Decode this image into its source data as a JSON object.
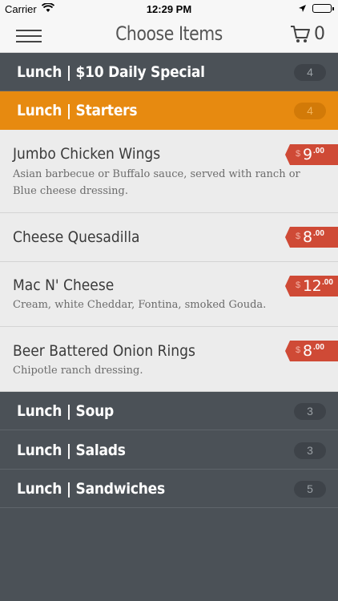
{
  "status_bar": {
    "carrier": "Carrier",
    "time": "12:29 PM"
  },
  "nav": {
    "title": "Choose Items",
    "cart_count": "0"
  },
  "sections_top": [
    {
      "label": "Lunch | $10 Daily Special",
      "count": "4"
    },
    {
      "label": "Lunch | Starters",
      "count": "4"
    }
  ],
  "items": [
    {
      "name": "Jumbo Chicken Wings",
      "description": "Asian barbecue or Buffalo sauce, served with ranch or Blue cheese dressing.",
      "currency": "$",
      "price": "9",
      "cents": ".00"
    },
    {
      "name": "Cheese Quesadilla",
      "description": "",
      "currency": "$",
      "price": "8",
      "cents": ".00"
    },
    {
      "name": "Mac N' Cheese",
      "description": "Cream, white Cheddar, Fontina, smoked Gouda.",
      "currency": "$",
      "price": "12",
      "cents": ".00"
    },
    {
      "name": "Beer Battered Onion Rings",
      "description": "Chipotle ranch dressing.",
      "currency": "$",
      "price": "8",
      "cents": ".00"
    }
  ],
  "sections_bottom": [
    {
      "label": "Lunch | Soup",
      "count": "3"
    },
    {
      "label": "Lunch | Salads",
      "count": "3"
    },
    {
      "label": "Lunch | Sandwiches",
      "count": "5"
    }
  ],
  "colors": {
    "accent": "#e78a10",
    "price_tag": "#cf4a36",
    "background": "#4b5157"
  },
  "icons": [
    "wifi-icon",
    "location-icon",
    "battery-icon",
    "hamburger-menu-icon",
    "cart-icon"
  ]
}
